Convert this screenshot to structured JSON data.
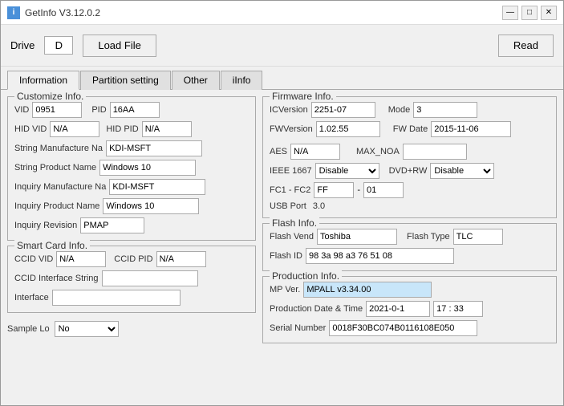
{
  "window": {
    "title": "GetInfo V3.12.0.2",
    "icon": "i",
    "controls": [
      "—",
      "□",
      "✕"
    ]
  },
  "toolbar": {
    "drive_label": "Drive",
    "drive_value": "D",
    "load_file_label": "Load File",
    "read_label": "Read"
  },
  "tabs": [
    "Information",
    "Partition setting",
    "Other",
    "iInfo"
  ],
  "active_tab": "Information",
  "customize_info": {
    "title": "Customize Info.",
    "vid_label": "VID",
    "vid_value": "0951",
    "pid_label": "PID",
    "pid_value": "16AA",
    "hid_vid_label": "HID VID",
    "hid_vid_value": "N/A",
    "hid_pid_label": "HID PID",
    "hid_pid_value": "N/A",
    "str_mfg_label": "String Manufacture Na",
    "str_mfg_value": "KDI-MSFT",
    "str_prod_label": "String Product Name",
    "str_prod_value": "Windows 10",
    "inq_mfg_label": "Inquiry Manufacture Na",
    "inq_mfg_value": "KDI-MSFT",
    "inq_prod_label": "Inquiry Product Name",
    "inq_prod_value": "Windows 10",
    "inq_rev_label": "Inquiry Revision",
    "inq_rev_value": "PMAP"
  },
  "smart_card_info": {
    "title": "Smart Card Info.",
    "ccid_vid_label": "CCID VID",
    "ccid_vid_value": "N/A",
    "ccid_pid_label": "CCID PID",
    "ccid_pid_value": "N/A",
    "ccid_iface_label": "CCID Interface String",
    "ccid_iface_value": "",
    "iface_label": "Interface",
    "iface_value": ""
  },
  "sample": {
    "label": "Sample Lo",
    "value": "No"
  },
  "firmware_info": {
    "title": "Firmware Info.",
    "ic_ver_label": "ICVersion",
    "ic_ver_value": "2251-07",
    "mode_label": "Mode",
    "mode_value": "3",
    "fw_ver_label": "FWVersion",
    "fw_ver_value": "1.02.55",
    "fw_date_label": "FW Date",
    "fw_date_value": "2015-11-06",
    "aes_label": "AES",
    "aes_value": "N/A",
    "max_noa_label": "MAX_NOA",
    "max_noa_value": "",
    "ieee_label": "IEEE 1667",
    "ieee_value": "Disable",
    "dvd_rw_label": "DVD+RW",
    "dvd_rw_value": "Disable",
    "fc_label": "FC1 - FC2",
    "fc1_value": "FF",
    "fc2_value": "01",
    "usb_port_label": "USB Port",
    "usb_port_value": "3.0"
  },
  "flash_info": {
    "title": "Flash Info.",
    "flash_vend_label": "Flash Vend",
    "flash_vend_value": "Toshiba",
    "flash_type_label": "Flash Type",
    "flash_type_value": "TLC",
    "flash_id_label": "Flash ID",
    "flash_id_value": "98 3a 98 a3 76 51 08"
  },
  "production_info": {
    "title": "Production Info.",
    "mp_ver_label": "MP Ver.",
    "mp_ver_value": "MPALL v3.34.00",
    "prod_date_label": "Production Date & Time",
    "prod_date_value": "2021-0-1",
    "prod_time_value": "17 : 33",
    "serial_label": "Serial Number",
    "serial_value": "0018F30BC074B0116108E050"
  }
}
